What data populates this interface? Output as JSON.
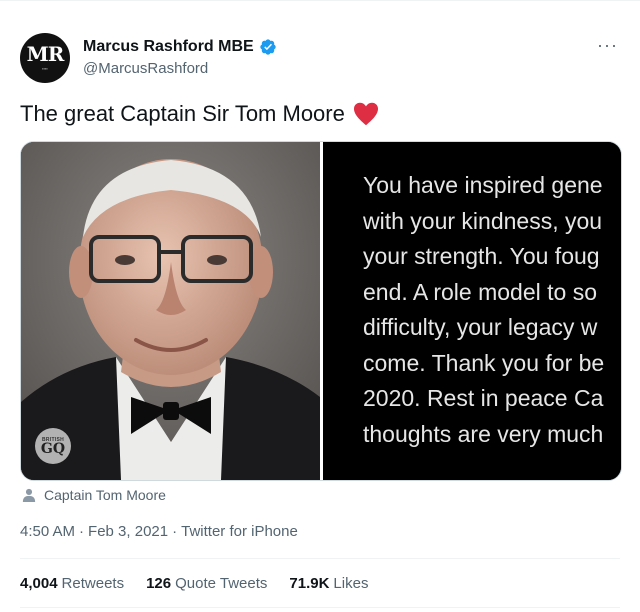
{
  "author": {
    "name": "Marcus Rashford MBE",
    "handle": "@MarcusRashford",
    "avatar_monogram": "MR",
    "verified_icon": "verified-badge-icon",
    "verified_color": "#1d9bf0"
  },
  "more_menu": "···",
  "tweet": {
    "text": "The great Captain Sir Tom Moore",
    "emoji_icon": "red-heart-icon",
    "heart_color": "#dd2e44"
  },
  "media": {
    "photo_badge": {
      "top": "BRITISH",
      "bottom": "GQ"
    },
    "quote_lines": [
      "You have inspired gene",
      "with your kindness, you",
      "your strength. You foug",
      "end. A role model to so",
      "difficulty, your legacy w",
      "come. Thank you for be",
      "2020. Rest in peace Ca",
      "thoughts are very much"
    ]
  },
  "tagged_user": "Captain Tom Moore",
  "meta": {
    "time": "4:50 AM",
    "separator": "·",
    "date": "Feb 3, 2021",
    "source": "Twitter for iPhone"
  },
  "stats": {
    "retweets_count": "4,004",
    "retweets_label": "Retweets",
    "quote_tweets_count": "126",
    "quote_tweets_label": "Quote Tweets",
    "likes_count": "71.9K",
    "likes_label": "Likes"
  }
}
